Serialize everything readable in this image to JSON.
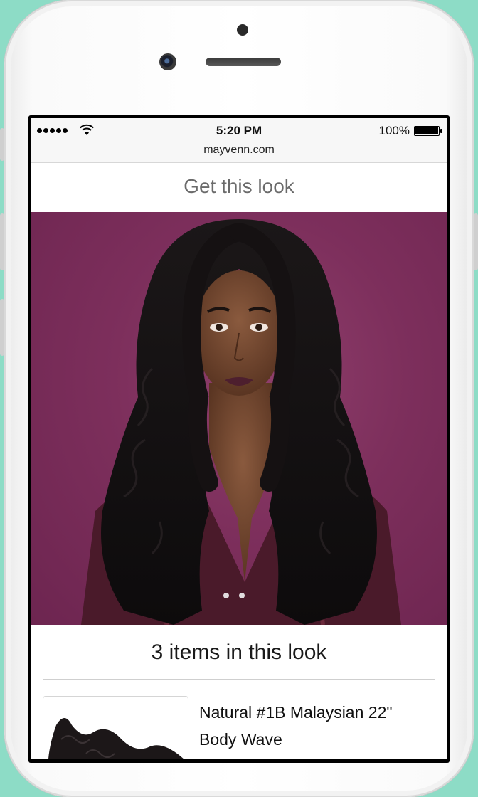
{
  "status_bar": {
    "time": "5:20 PM",
    "battery": "100%"
  },
  "browser": {
    "url": "mayvenn.com"
  },
  "page": {
    "title": "Get this look"
  },
  "hero": {
    "carousel_count": 2,
    "active_index": 0
  },
  "look": {
    "items_count_label": "3 items in this look",
    "products": [
      {
        "name": "Natural #1B Malaysian 22\" Body Wave"
      }
    ]
  },
  "colors": {
    "hero_background": "#7d2f5c",
    "device_background": "#8ddcc6",
    "title_text": "#6b6b6b"
  },
  "icons": [
    "signal-icon",
    "wifi-icon",
    "battery-icon"
  ]
}
